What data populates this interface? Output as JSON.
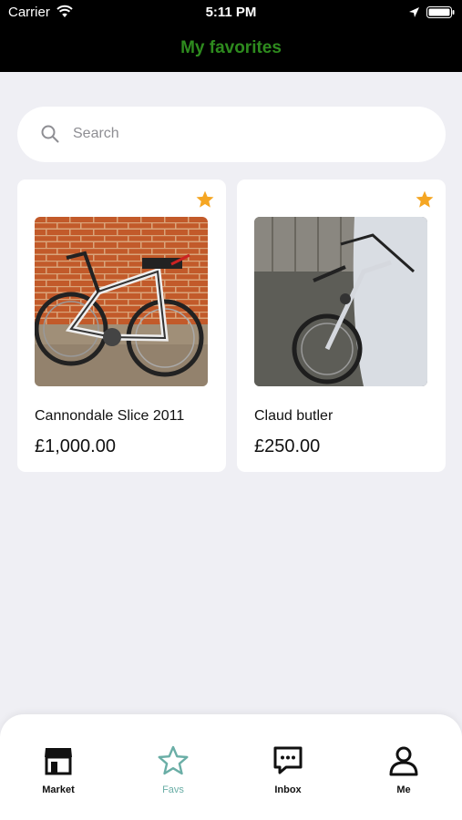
{
  "status_bar": {
    "carrier": "Carrier",
    "time": "5:11 PM"
  },
  "nav": {
    "title": "My favorites"
  },
  "search": {
    "placeholder": "Search"
  },
  "colors": {
    "title_green": "#2e8b1e",
    "star": "#f5a623",
    "active_tab": "#6aaea6"
  },
  "listings": [
    {
      "name": "Cannondale Slice 2011",
      "price": "£1,000.00"
    },
    {
      "name": "Claud butler",
      "price": "£250.00"
    }
  ],
  "tabs": [
    {
      "label": "Market",
      "icon": "store-icon"
    },
    {
      "label": "Favs",
      "icon": "star-outline-icon"
    },
    {
      "label": "Inbox",
      "icon": "chat-bubble-icon"
    },
    {
      "label": "Me",
      "icon": "person-icon"
    }
  ]
}
